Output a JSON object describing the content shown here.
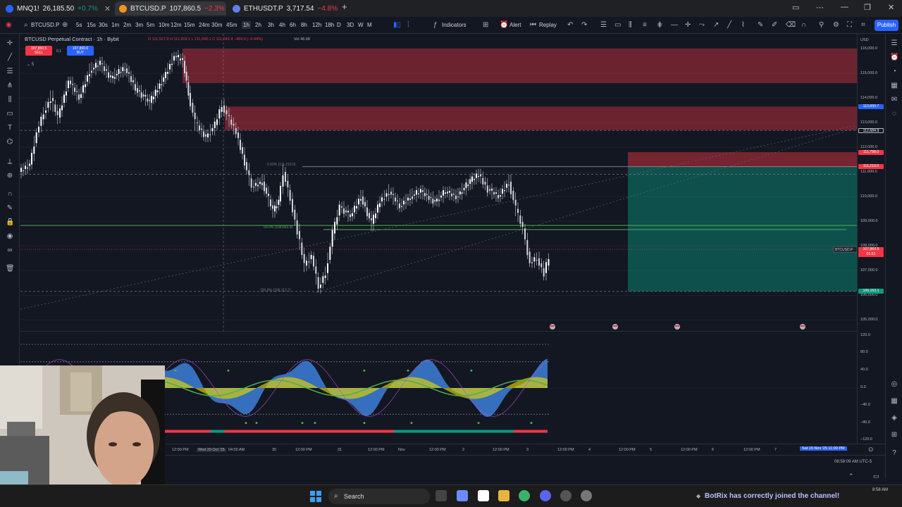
{
  "browser": {
    "tabs": [
      {
        "title": "MNQ1!",
        "price": "26,185.50",
        "change": "+0.7%",
        "up": true,
        "color": "#2962ff"
      },
      {
        "title": "BTCUSD.P",
        "price": "107,860.5",
        "change": "−2.3%",
        "up": false,
        "color": "#f7931a"
      },
      {
        "title": "ETHUSDT.P",
        "price": "3,717.54",
        "change": "−4.8%",
        "up": false,
        "color": "#627eea"
      }
    ],
    "new_tab": "+"
  },
  "toolbar": {
    "symbol": "BTCUSD.P",
    "intervals": [
      "5s",
      "15s",
      "30s",
      "1m",
      "2m",
      "3m",
      "5m",
      "10m",
      "12m",
      "15m",
      "24m",
      "30m",
      "45m",
      "1h",
      "2h",
      "3h",
      "4h",
      "6h",
      "8h",
      "12h",
      "18h",
      "D",
      "3D",
      "W",
      "M"
    ],
    "active_interval": "1h",
    "indicators_label": "Indicators",
    "alert_label": "Alert",
    "replay_label": "Replay",
    "publish_label": "Publish"
  },
  "chart": {
    "title": "BTCUSD Perpetual Contract · 1h · Bybit",
    "ohlc": "O 111,527.9  H 111,918.1  L 111,042.1  C 111,042.4  −494.6 (−0.44%)",
    "vol": "Vol 46.68",
    "sell_price": "107,860.5",
    "sell_label": "SELL",
    "buy_price": "107,860.6",
    "buy_label": "BUY",
    "spread": "0.1",
    "layers": "5",
    "fib_labels": [
      "0.00% (111,210.0)",
      "50.0% (108,661.9)",
      "100.0% (106,113.7)"
    ],
    "price_tag_symbol": "BTCUSD.P",
    "currency": "USD",
    "colors": {
      "bull": "#089981",
      "bear": "#f23645",
      "zone_red": "#f23645",
      "zone_green": "#089981",
      "accent": "#2962ff"
    }
  },
  "price_axis": {
    "labels": [
      "116,000.0",
      "115,000.0",
      "114,000.0",
      "113,000.0",
      "112,000.0",
      "111,000.0",
      "110,000.0",
      "109,000.0",
      "108,000.0",
      "107,000.0",
      "106,000.0",
      "105,000.0"
    ],
    "tags": [
      {
        "text": "113,650.7",
        "color": "#2962ff",
        "y_price": 113650.7
      },
      {
        "text": "112,684.9",
        "color": "#131722",
        "y_price": 112684.9
      },
      {
        "text": "111,798.0",
        "color": "#f23645",
        "y_price": 111798.0
      },
      {
        "text": "111,210.0",
        "color": "#f23645",
        "y_price": 111210.0
      },
      {
        "text": "107,860.5",
        "color": "#f23645",
        "y_price": 107860.5
      },
      {
        "text": "01:51",
        "color": "#f23645",
        "y_price": 107660.0
      },
      {
        "text": "106,153.1",
        "color": "#089981",
        "y_price": 106153.1
      }
    ]
  },
  "indicator_axis": {
    "labels": [
      "120.0",
      "80.0",
      "40.0",
      "0.0",
      "−40.0",
      "−80.0",
      "−120.0"
    ]
  },
  "time_axis": {
    "labels": [
      "12:00 PM",
      "Wed 29 Oct '25",
      "04:00 AM",
      "30",
      "12:00 PM",
      "31",
      "12:00 PM",
      "Nov",
      "12:00 PM",
      "2",
      "12:00 PM",
      "3",
      "12:00 PM",
      "4",
      "12:00 PM",
      "5",
      "12:00 PM",
      "6",
      "12:00 PM",
      "7"
    ],
    "cursor_label": "Sat 15 Nov '25  11:00 PM",
    "clock": "08:58:09 AM UTC-5"
  },
  "taskbar": {
    "search_placeholder": "Search",
    "notification": "BotRix has correctly joined the channel!",
    "notification_name": "BotRix",
    "time": "8:58 AM"
  }
}
